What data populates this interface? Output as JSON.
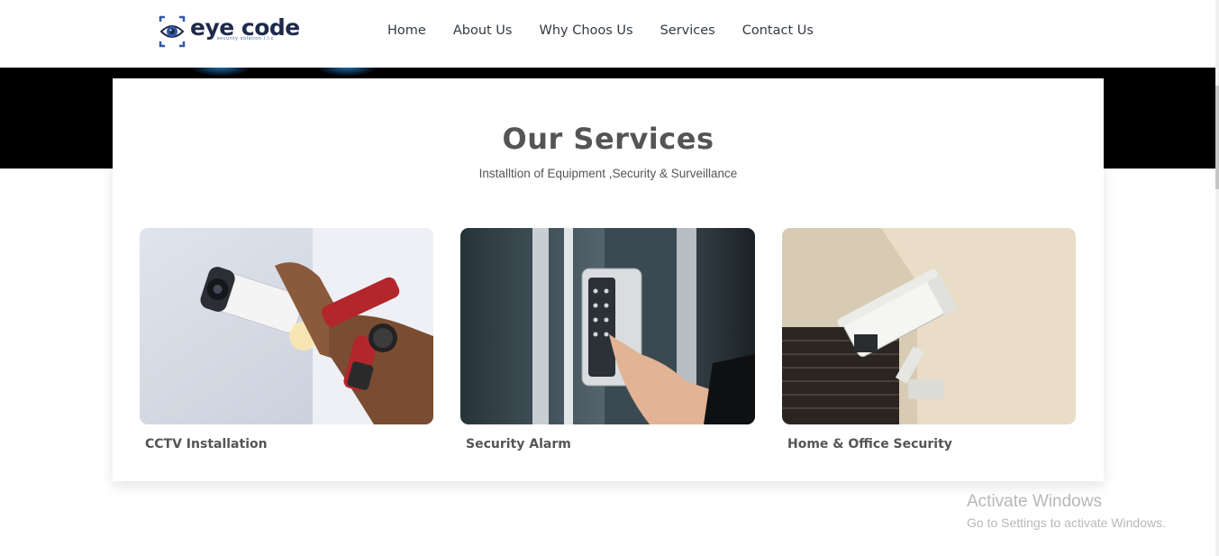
{
  "brand": {
    "name": "eye code",
    "tagline": "security solution l.l.c",
    "colors": {
      "primary": "#1f2a4a",
      "accent": "#2f5aa6"
    }
  },
  "nav": [
    {
      "label": "Home"
    },
    {
      "label": "About Us"
    },
    {
      "label": "Why Choos Us"
    },
    {
      "label": "Services"
    },
    {
      "label": "Contact Us"
    }
  ],
  "services": {
    "title": "Our Services",
    "subtitle": "Installtion of Equipment ,Security & Surveillance",
    "cards": [
      {
        "label": "CCTV Installation",
        "image": "cctv-installation-photo"
      },
      {
        "label": "Security Alarm",
        "image": "security-alarm-keypad-photo"
      },
      {
        "label": "Home & Office Security",
        "image": "wall-mounted-camera-photo"
      }
    ]
  },
  "watermark": {
    "title": "Activate Windows",
    "subtitle": "Go to Settings to activate Windows."
  }
}
